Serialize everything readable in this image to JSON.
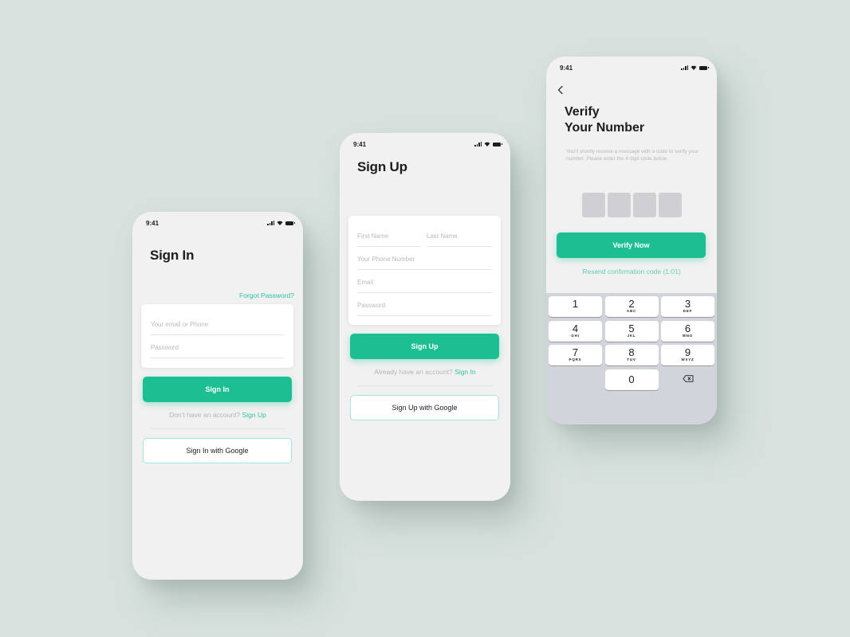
{
  "colors": {
    "background": "#d8e1de",
    "accent": "#1cbf92",
    "link": "#2dc49b",
    "google_border": "#a7e3e2",
    "code_box": "#d0d0d4",
    "keypad_bg": "#d1d4db"
  },
  "status_bar": {
    "time": "9:41",
    "icons": [
      "signal-icon",
      "wifi-icon",
      "battery-icon"
    ]
  },
  "signin": {
    "title": "Sign In",
    "forgot_password": "Forgot Password?",
    "fields": [
      {
        "placeholder": "Your email or Phone",
        "value": ""
      },
      {
        "placeholder": "Password",
        "value": ""
      }
    ],
    "primary_button": "Sign In",
    "helper_text": "Don't have an account?",
    "helper_link": "Sign Up",
    "google_button": "Sign In with Google"
  },
  "signup": {
    "title": "Sign Up",
    "fields": [
      {
        "placeholder": "First Name",
        "value": ""
      },
      {
        "placeholder": "Last Name",
        "value": ""
      },
      {
        "placeholder": "Your Phone Number",
        "value": ""
      },
      {
        "placeholder": "Email",
        "value": ""
      },
      {
        "placeholder": "Password",
        "value": ""
      }
    ],
    "primary_button": "Sign Up",
    "helper_text": "Already have an account?",
    "helper_link": "Sign In",
    "google_button": "Sign Up with Google"
  },
  "verify": {
    "back_icon": "chevron-left-icon",
    "title_line1": "Verify",
    "title_line2": "Your Number",
    "description": "You'll shortly receive a message with a code to verify your number. Please enter the 4 digit code below",
    "code_length": 4,
    "primary_button": "Verify Now",
    "resend": "Resend confirmation code (1:01)",
    "keypad": [
      {
        "num": "1",
        "letters": ""
      },
      {
        "num": "2",
        "letters": "ABC"
      },
      {
        "num": "3",
        "letters": "DEF"
      },
      {
        "num": "4",
        "letters": "GHI"
      },
      {
        "num": "5",
        "letters": "JKL"
      },
      {
        "num": "6",
        "letters": "MNO"
      },
      {
        "num": "7",
        "letters": "PQRS"
      },
      {
        "num": "8",
        "letters": "TUV"
      },
      {
        "num": "9",
        "letters": "WXYZ"
      },
      {
        "num": "0",
        "letters": ""
      }
    ],
    "delete_icon": "backspace-icon"
  }
}
